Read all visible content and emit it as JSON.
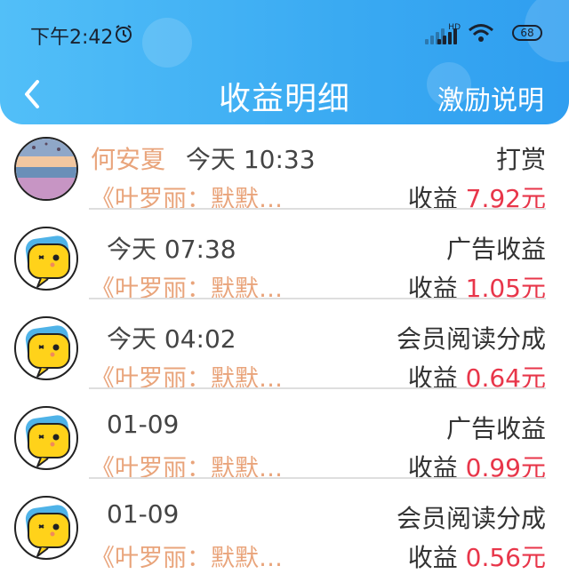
{
  "status_bar": {
    "time": "下午2:42",
    "battery": "68",
    "network_tag": "HD"
  },
  "header": {
    "title": "收益明细",
    "right_link": "激励说明",
    "back_icon": "chevron-left-icon"
  },
  "rows": [
    {
      "name": "何安夏",
      "time": "今天 10:33",
      "type": "打赏",
      "source": "《叶罗丽：默默…",
      "earn_label": "收益",
      "amount": "7.92元",
      "avatar": "photo"
    },
    {
      "name": "",
      "time": "今天 07:38",
      "type": "广告收益",
      "source": "《叶罗丽：默默…",
      "earn_label": "收益",
      "amount": "1.05元",
      "avatar": "cartoon"
    },
    {
      "name": "",
      "time": "今天 04:02",
      "type": "会员阅读分成",
      "source": "《叶罗丽：默默…",
      "earn_label": "收益",
      "amount": "0.64元",
      "avatar": "cartoon"
    },
    {
      "name": "",
      "time": "01-09",
      "type": "广告收益",
      "source": "《叶罗丽：默默…",
      "earn_label": "收益",
      "amount": "0.99元",
      "avatar": "cartoon"
    },
    {
      "name": "",
      "time": "01-09",
      "type": "会员阅读分成",
      "source": "《叶罗丽：默默…",
      "earn_label": "收益",
      "amount": "0.56元",
      "avatar": "cartoon"
    }
  ],
  "colors": {
    "header_start": "#52bff8",
    "header_end": "#2f9ef0",
    "name_orange": "#e9a47b",
    "amount_red": "#e8364a"
  }
}
